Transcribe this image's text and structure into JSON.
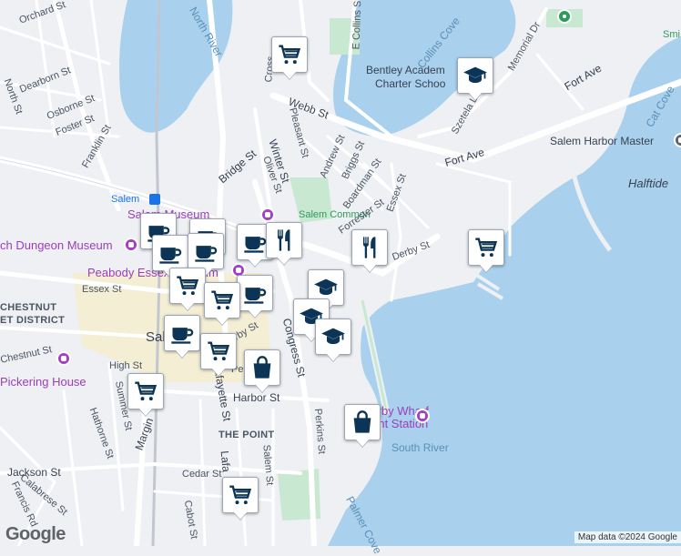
{
  "map": {
    "colors": {
      "water": "#a9d1ee",
      "land": "#eef0f3",
      "park": "#c9e8d2",
      "road": "#ffffff",
      "business": "#f6ecc0",
      "pin_icon": "#0b3457"
    },
    "attribution": "Map data ©2024 Google",
    "logo": "Google"
  },
  "labels": {
    "north_river": "North River",
    "collins_cove": "Collins Cove",
    "cat_cove": "Cat Cove",
    "south_river": "South River",
    "palmer_cove": "Palmer Cove",
    "halftide": "Halftide",
    "salem_harbor_master": "Salem Harbor Master",
    "smi": "Smi",
    "bentley_1": "Bentley Academ",
    "bentley_2": "Charter Schoo",
    "salem_station": "Salem",
    "salem_museum": "Salem Museum",
    "dungeon_museum": "ch Dungeon Museum",
    "peabody_essex": "Peabody Essex Museum",
    "pickering_house": "Pickering House",
    "derby_wharf_1": "Derby Wharf",
    "derby_wharf_2": "Light Station",
    "salem_city": "Salem",
    "chestnut_district_1": "CHESTNUT",
    "chestnut_district_2": "ET DISTRICT",
    "the_point": "THE POINT",
    "salem_common": "Salem Common"
  },
  "streets": {
    "orchard": "Orchard St",
    "e_collins": "E Collins St",
    "north": "North St",
    "dearborn": "Dearborn St",
    "osborne": "Osborne St",
    "foster": "Foster St",
    "franklin": "Franklin St",
    "webb": "Webb St",
    "pleasant": "Pleasant St",
    "winter": "Winter St",
    "bridge": "Bridge St",
    "oliver": "Oliver St",
    "andrew": "Andrew St",
    "briggs": "Briggs St",
    "boardman": "Boardman St",
    "forrester": "Forrester St",
    "essex_e": "Essex St",
    "essex_w": "Essex St",
    "derby": "Derby St",
    "derby_w": "rby St",
    "memorial": "Memorial Dr",
    "szetela": "Szetela Ln",
    "fort_ave_1": "Fort Ave",
    "fort_ave_2": "Fort Ave",
    "congress": "Congress St",
    "lafayette": "Lafayette St",
    "harbor": "Harbor St",
    "perkins": "Perkins St",
    "pe": "Pe",
    "chestnut": "Chestnut St",
    "high": "High St",
    "summer": "Summer St",
    "margin": "Margin",
    "hathorne": "Hathorne St",
    "jackson": "Jackson St",
    "calabrese": "Calabrese St",
    "francis": "Francis Rd",
    "cedar": "Cedar St",
    "cabot": "Cabot St",
    "salem_st": "Salem St",
    "lafa": "Lafa",
    "cross": "Cross"
  },
  "pins": [
    {
      "type": "grocery",
      "icon": "shopping-cart-icon"
    },
    {
      "type": "school",
      "icon": "graduation-cap-icon"
    },
    {
      "type": "cafe",
      "icon": "coffee-cup-icon"
    },
    {
      "type": "cafe",
      "icon": "coffee-cup-icon"
    },
    {
      "type": "cafe",
      "icon": "coffee-cup-icon"
    },
    {
      "type": "cafe",
      "icon": "coffee-cup-icon"
    },
    {
      "type": "cafe",
      "icon": "coffee-cup-icon"
    },
    {
      "type": "cafe",
      "icon": "coffee-cup-icon"
    },
    {
      "type": "cafe",
      "icon": "coffee-cup-icon"
    },
    {
      "type": "grocery",
      "icon": "shopping-cart-icon"
    },
    {
      "type": "grocery",
      "icon": "shopping-cart-icon"
    },
    {
      "type": "grocery",
      "icon": "shopping-cart-icon"
    },
    {
      "type": "shopping",
      "icon": "shopping-bag-icon"
    },
    {
      "type": "shopping",
      "icon": "shopping-bag-icon"
    },
    {
      "type": "restaurant",
      "icon": "fork-knife-icon"
    },
    {
      "type": "restaurant",
      "icon": "fork-knife-icon"
    },
    {
      "type": "school",
      "icon": "graduation-cap-icon"
    },
    {
      "type": "school",
      "icon": "graduation-cap-icon"
    },
    {
      "type": "school",
      "icon": "graduation-cap-icon"
    },
    {
      "type": "grocery",
      "icon": "shopping-cart-icon"
    },
    {
      "type": "grocery",
      "icon": "shopping-cart-icon"
    },
    {
      "type": "grocery",
      "icon": "shopping-cart-icon"
    }
  ]
}
